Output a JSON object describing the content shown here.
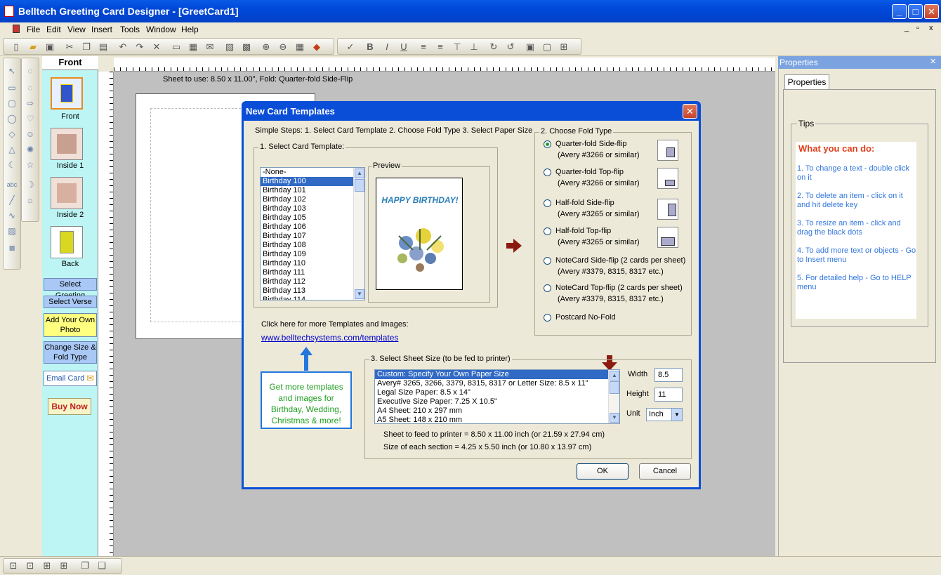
{
  "window": {
    "title": "Belltech Greeting Card Designer  - [GreetCard1]",
    "min": "_",
    "max": "□",
    "close": "✕"
  },
  "menu": [
    "File",
    "Edit",
    "View",
    "Insert",
    "Tools",
    "Window",
    "Help"
  ],
  "mdi_controls": [
    "_",
    "▫",
    "x"
  ],
  "page_panel": {
    "title": "Front",
    "thumbs": [
      "Front",
      "Inside 1",
      "Inside 2",
      "Back"
    ],
    "buttons": {
      "select_greeting": "Select Greeting",
      "select_verse": "Select Verse",
      "add_photo": "Add Your Own Photo",
      "change_size": "Change Size & Fold Type",
      "email_card": "Email Card",
      "buy_now": "Buy Now"
    }
  },
  "canvas": {
    "sheet_info": "Sheet to use: 8.50 x 11.00\", Fold: Quarter-fold Side-Flip"
  },
  "properties": {
    "header": "Properties",
    "close": "✕",
    "tab": "Properties",
    "tips_legend": "Tips",
    "tips_title": "What you can do:",
    "tips": [
      "1. To change a text - double click on it",
      "2. To delete an item - click on it and hit delete key",
      "3. To resize an item - click and drag the black dots",
      "4. To add more text or objects - Go to Insert menu",
      "5. For detailed help - Go to HELP menu"
    ]
  },
  "dialog": {
    "title": "New Card Templates",
    "close": "✕",
    "steps": "Simple Steps: 1. Select Card Template  2. Choose Fold Type  3. Select Paper Size",
    "template_group": "1. Select Card Template:",
    "preview_label": "Preview",
    "preview_text": "HAPPY BIRTHDAY!",
    "templates": [
      "-None-",
      "Birthday 100",
      "Birthday 101",
      "Birthday 102",
      "Birthday 103",
      "Birthday 105",
      "Birthday 106",
      "Birthday 107",
      "Birthday 108",
      "Birthday 109",
      "Birthday 110",
      "Birthday 111",
      "Birthday 112",
      "Birthday 113",
      "Birthday 114"
    ],
    "fold_group": "2. Choose Fold Type",
    "folds": [
      {
        "label": "Quarter-fold Side-flip",
        "sub": "(Avery #3266 or similar)",
        "checked": true
      },
      {
        "label": "Quarter-fold Top-flip",
        "sub": "(Avery #3266 or similar)",
        "checked": false
      },
      {
        "label": "Half-fold Side-flip",
        "sub": "(Avery #3265 or similar)",
        "checked": false
      },
      {
        "label": "Half-fold Top-flip",
        "sub": "(Avery #3265 or similar)",
        "checked": false
      },
      {
        "label": "NoteCard Side-flip (2 cards per sheet)",
        "sub": "(Avery #3379, 8315, 8317 etc.)",
        "checked": false
      },
      {
        "label": "NoteCard Top-flip (2 cards per sheet)",
        "sub": "(Avery #3379, 8315, 8317 etc.)",
        "checked": false
      },
      {
        "label": "Postcard No-Fold",
        "sub": "",
        "checked": false
      }
    ],
    "more_label": "Click here for more Templates and Images:",
    "more_link": "www.belltechsystems.com/templates",
    "promo": "Get more templates and images for Birthday, Wedding, Christmas & more!",
    "sheet_group": "3. Select Sheet Size (to be fed to printer)",
    "papers": [
      "Custom: Specify Your Own Paper Size",
      "Avery# 3265, 3266, 3379, 8315, 8317 or Letter Size: 8.5 x 11\"",
      "Legal Size Paper: 8.5 x 14\"",
      "Executive Size Paper: 7.25  X 10.5\"",
      "A4 Sheet: 210 x 297 mm",
      "A5 Sheet: 148 x 210 mm"
    ],
    "width_label": "Width",
    "width_value": "8.5",
    "height_label": "Height",
    "height_value": "11",
    "unit_label": "Unit",
    "unit_value": "Inch",
    "feed_text": "Sheet to feed to printer = 8.50 x 11.00 inch (or 21.59 x 27.94 cm)",
    "section_text": "Size of each section = 4.25 x 5.50 inch (or 10.80 x 13.97 cm)",
    "ok": "OK",
    "cancel": "Cancel"
  }
}
